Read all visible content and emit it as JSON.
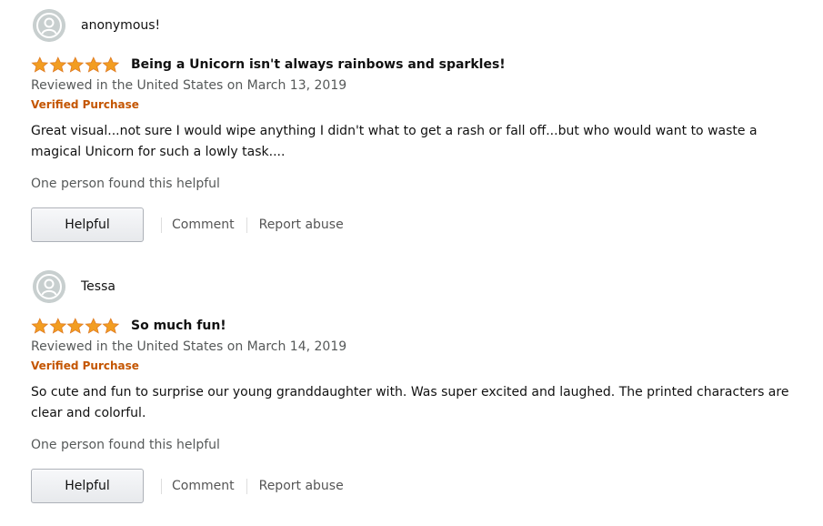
{
  "colors": {
    "star": "#f29d21",
    "verified": "#c45500",
    "muted_text": "#565959",
    "avatar_bg": "#c8cfcf"
  },
  "reviews": [
    {
      "profile_name": "anonymous!",
      "rating": 5,
      "title": "Being a Unicorn isn't always rainbows and sparkles!",
      "date": "Reviewed in the United States on March 13, 2019",
      "verified": "Verified Purchase",
      "body": "Great visual...not sure I would wipe anything I didn't what to get a rash or fall off...but who would want to waste a magical Unicorn for such a lowly task....",
      "helpful_count": "One person found this helpful",
      "helpful_label": "Helpful",
      "comment_label": "Comment",
      "report_label": "Report abuse"
    },
    {
      "profile_name": "Tessa",
      "rating": 5,
      "title": "So much fun!",
      "date": "Reviewed in the United States on March 14, 2019",
      "verified": "Verified Purchase",
      "body": "So cute and fun to surprise our young granddaughter with. Was super excited and laughed. The printed characters are clear and colorful.",
      "helpful_count": "One person found this helpful",
      "helpful_label": "Helpful",
      "comment_label": "Comment",
      "report_label": "Report abuse"
    }
  ]
}
